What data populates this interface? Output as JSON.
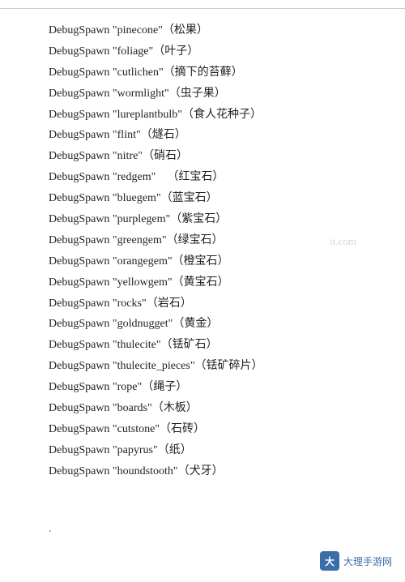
{
  "divider": true,
  "entries": [
    {
      "command": "DebugSpawn",
      "item": "\"pinecone\"",
      "translation": "（松果）"
    },
    {
      "command": "DebugSpawn",
      "item": "\"foliage\"",
      "translation": "（叶子）"
    },
    {
      "command": "DebugSpawn",
      "item": "\"cutlichen\"",
      "translation": "（摘下的苔藓）"
    },
    {
      "command": "DebugSpawn",
      "item": "\"wormlight\"",
      "translation": "（虫子果）"
    },
    {
      "command": "DebugSpawn",
      "item": "\"lureplantbulb\"",
      "translation": "（食人花种子）"
    },
    {
      "command": "DebugSpawn",
      "item": "\"flint\"",
      "translation": "（燧石）"
    },
    {
      "command": "DebugSpawn",
      "item": "\"nitre\"",
      "translation": "（硝石）"
    },
    {
      "command": "DebugSpawn",
      "item": "\"redgem\"",
      "translation": "（红宝石）"
    },
    {
      "command": "DebugSpawn",
      "item": "\"bluegem\"",
      "translation": "（蓝宝石）"
    },
    {
      "command": "DebugSpawn",
      "item": "\"purplegem\"",
      "translation": "（紫宝石）"
    },
    {
      "command": "DebugSpawn",
      "item": "\"greengem\"",
      "translation": "（绿宝石）"
    },
    {
      "command": "DebugSpawn",
      "item": "\"orangegem\"",
      "translation": "（橙宝石）"
    },
    {
      "command": "DebugSpawn",
      "item": "\"yellowgem\"",
      "translation": "（黄宝石）"
    },
    {
      "command": "DebugSpawn",
      "item": "\"rocks\"",
      "translation": "（岩石）"
    },
    {
      "command": "DebugSpawn",
      "item": "\"goldnugget\"",
      "translation": "（黄金）"
    },
    {
      "command": "DebugSpawn",
      "item": "\"thulecite\"",
      "translation": "（铥矿石）"
    },
    {
      "command": "DebugSpawn",
      "item": "\"thulecite_pieces\"",
      "translation": "（铥矿碎片）"
    },
    {
      "command": "DebugSpawn",
      "item": "\"rope\"",
      "translation": "（绳子）"
    },
    {
      "command": "DebugSpawn",
      "item": "\"boards\"",
      "translation": "（木板）"
    },
    {
      "command": "DebugSpawn",
      "item": "\"cutstone\"",
      "translation": "（石砖）"
    },
    {
      "command": "DebugSpawn",
      "item": "\"papyrus\"",
      "translation": "（纸）"
    },
    {
      "command": "DebugSpawn",
      "item": "\"houndstooth\"",
      "translation": "（犬牙）"
    }
  ],
  "dot": ".",
  "watermark": "it.com",
  "logo": {
    "icon_text": "大",
    "label": "大理手游网"
  }
}
